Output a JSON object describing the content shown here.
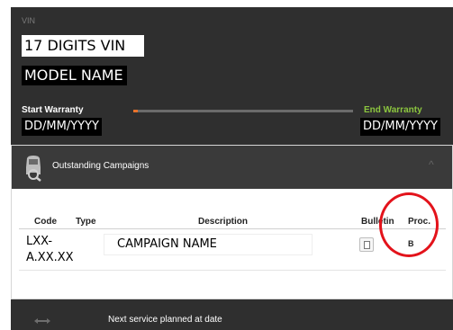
{
  "vehicle": {
    "vin_label": "VIN",
    "vin_value": "17 DIGITS VIN",
    "model_name": "MODEL NAME"
  },
  "warranty": {
    "start_label": "Start Warranty",
    "start_value": "DD/MM/YYYY",
    "end_label": "End Warranty",
    "end_value": "DD/MM/YYYY",
    "progress_fraction": 0.02,
    "accent_color": "#e8722a",
    "end_label_color": "#8cc63f"
  },
  "campaigns": {
    "title": "Outstanding Campaigns",
    "icon": "car-search-icon",
    "collapse_icon": "chevron-up-icon",
    "columns": {
      "code": "Code",
      "type": "Type",
      "description": "Description",
      "bulletin": "Bulletin",
      "proc": "Proc."
    },
    "rows": [
      {
        "code": "LXX-A.XX.XX",
        "type": "",
        "description": "CAMPAIGN NAME",
        "bulletin_icon": "document-icon",
        "proc": "B"
      }
    ]
  },
  "annotation": {
    "color": "#e3131b"
  },
  "service": {
    "icon": "wrench-icon",
    "text": "Next service planned at date"
  }
}
